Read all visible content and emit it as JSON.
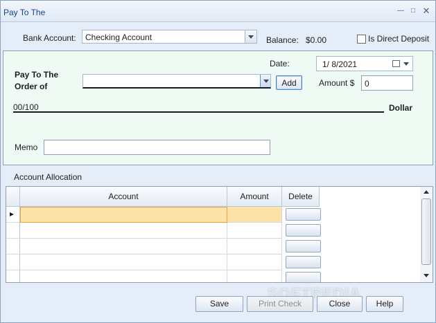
{
  "window": {
    "title": "Pay To The"
  },
  "header": {
    "bank_account_label": "Bank Account:",
    "bank_account_value": "Checking Account",
    "balance_label": "Balance:",
    "balance_value": "$0.00",
    "direct_deposit_label": "Is Direct Deposit",
    "direct_deposit_checked": false
  },
  "check": {
    "date_label": "Date:",
    "date_value": "1/  8/2021",
    "pay_to_label_line1": "Pay To The",
    "pay_to_label_line2": "Order of",
    "payee_value": "",
    "add_label": "Add",
    "amount_label": "Amount $",
    "amount_value": "0",
    "amount_words": "00/100",
    "dollar_label": "Dollar",
    "memo_label": "Memo",
    "memo_value": ""
  },
  "allocation": {
    "title": "Account Allocation",
    "columns": [
      "Account",
      "Amount",
      "Delete"
    ],
    "row_indicator": "▸"
  },
  "buttons": {
    "save": "Save",
    "print_check": "Print Check",
    "close": "Close",
    "help": "Help"
  },
  "watermark": "SOFTPEDIA",
  "colors": {
    "check_bg": "#eefaf3",
    "window_bg": "#e4edf8",
    "selected_row": "#fde3a7",
    "title_text": "#15428b"
  }
}
